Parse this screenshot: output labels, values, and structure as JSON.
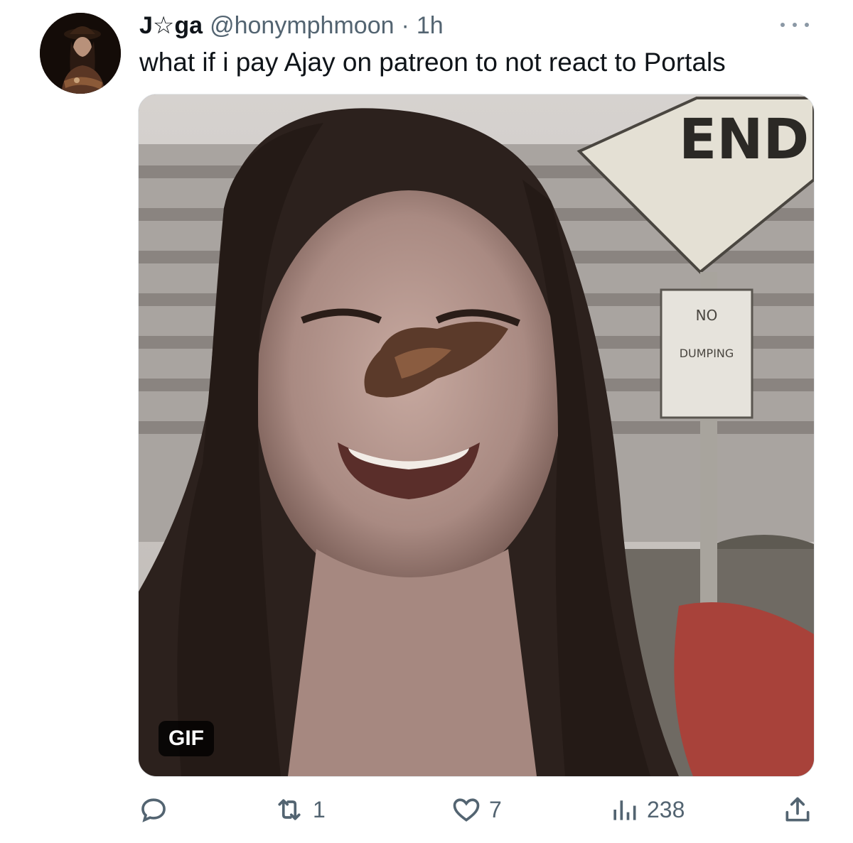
{
  "tweet": {
    "display_name": "J☆ga",
    "handle": "@honymphmoon",
    "separator": "·",
    "time": "1h",
    "text": "what if i pay Ajay on patreon to not react to Portals"
  },
  "media": {
    "type_badge": "GIF",
    "sign_top": "END",
    "sign_bottom_line1": "NO",
    "sign_bottom_line2": "DUMPING"
  },
  "actions": {
    "reply_icon": "reply-icon",
    "reply_count": "",
    "retweet_icon": "retweet-icon",
    "retweet_count": "1",
    "like_icon": "heart-icon",
    "like_count": "7",
    "views_icon": "views-icon",
    "views_count": "238",
    "share_icon": "share-icon"
  },
  "colors": {
    "text_primary": "#0f1419",
    "text_secondary": "#536471",
    "background": "#ffffff"
  }
}
